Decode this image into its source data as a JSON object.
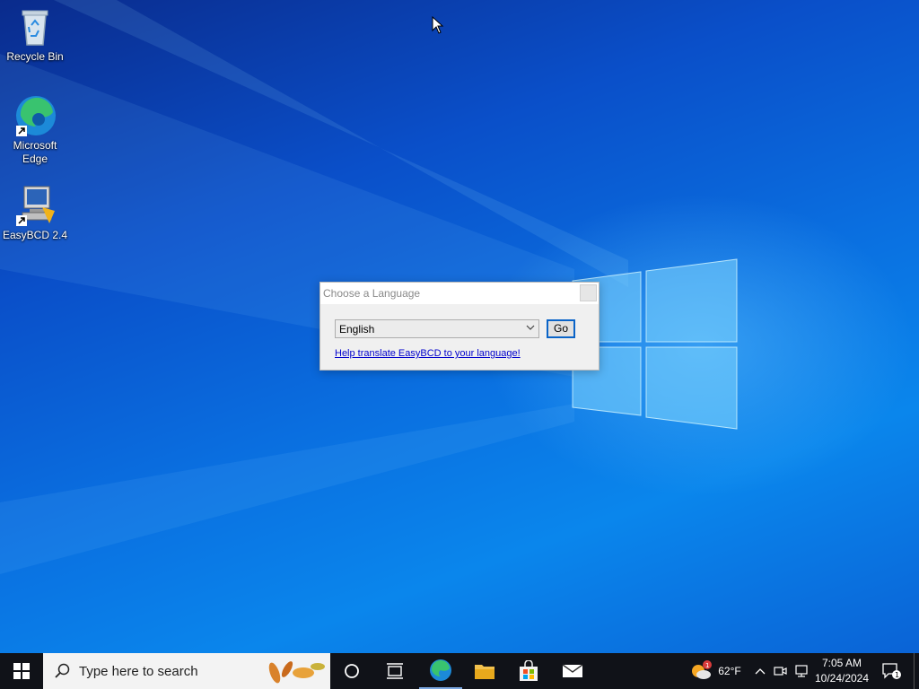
{
  "desktop": {
    "icons": [
      {
        "label": "Recycle Bin"
      },
      {
        "label": "Microsoft\nEdge"
      },
      {
        "label": "EasyBCD 2.4"
      }
    ]
  },
  "dialog": {
    "title": "Choose a Language",
    "language_select": {
      "selected": "English"
    },
    "go_label": "Go",
    "help_link": "Help translate EasyBCD to your language!"
  },
  "taskbar": {
    "search_placeholder": "Type here to search",
    "weather": {
      "temp": "62°F",
      "badge": "1"
    },
    "clock": {
      "time": "7:05 AM",
      "date": "10/24/2024"
    },
    "notification_count": "1"
  },
  "colors": {
    "accent": "#0a64c8",
    "taskbar": "#101218",
    "desktop": "#0a6fe0"
  }
}
